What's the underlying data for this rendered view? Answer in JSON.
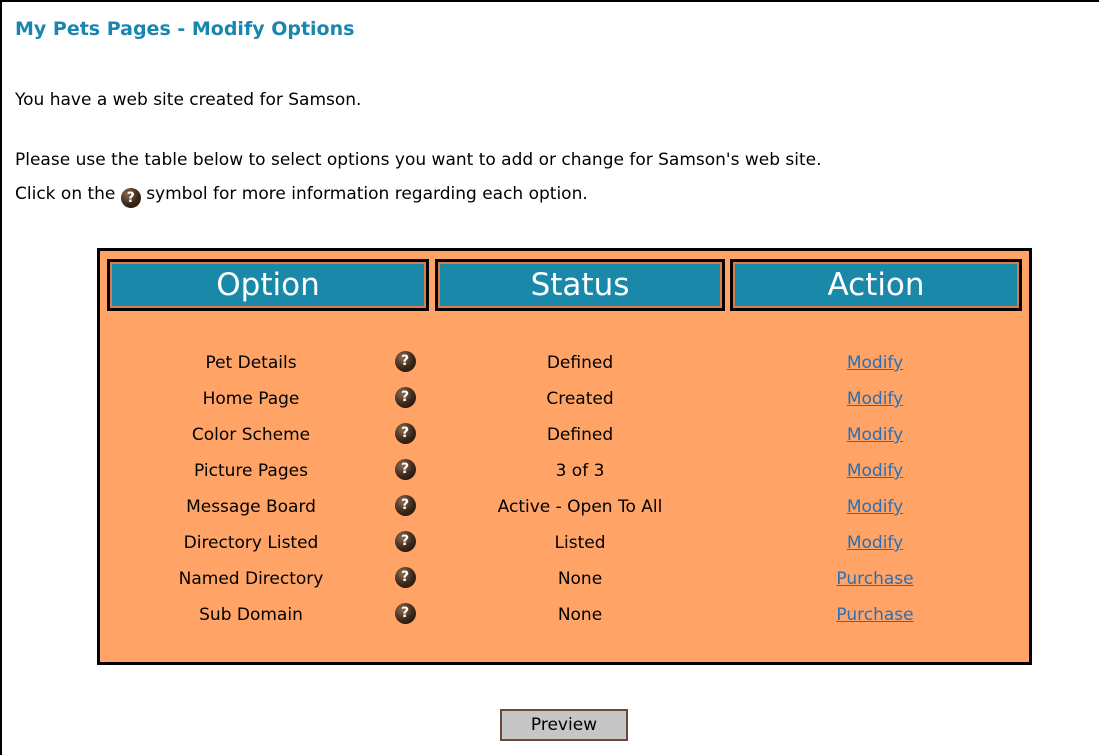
{
  "page": {
    "title": "My Pets Pages - Modify Options",
    "intro": "You have a web site created for Samson.",
    "instructions_line1": "Please use the table below to select options you want to add or change for Samson's web site.",
    "instructions_line2_prefix": "Click on the",
    "instructions_line2_suffix": "symbol for more information regarding each option.",
    "help_glyph": "?"
  },
  "table": {
    "headers": {
      "option": "Option",
      "status": "Status",
      "action": "Action"
    },
    "rows": [
      {
        "option": "Pet Details",
        "status": "Defined",
        "action": "Modify"
      },
      {
        "option": "Home Page",
        "status": "Created",
        "action": "Modify"
      },
      {
        "option": "Color Scheme",
        "status": "Defined",
        "action": "Modify"
      },
      {
        "option": "Picture Pages",
        "status": "3 of 3",
        "action": "Modify"
      },
      {
        "option": "Message Board",
        "status": "Active - Open To All",
        "action": "Modify"
      },
      {
        "option": "Directory Listed",
        "status": "Listed",
        "action": "Modify"
      },
      {
        "option": "Named Directory",
        "status": "None",
        "action": "Purchase"
      },
      {
        "option": "Sub Domain",
        "status": "None",
        "action": "Purchase"
      }
    ]
  },
  "preview_button": {
    "label": "Preview"
  },
  "colors": {
    "title": "#1a86b0",
    "table_background": "#ffa466",
    "header_background": "#1a88a8",
    "link": "#2a6fb4",
    "button_background": "#c6c6c6"
  },
  "icons": {
    "help": "question-mark-circle-icon"
  }
}
